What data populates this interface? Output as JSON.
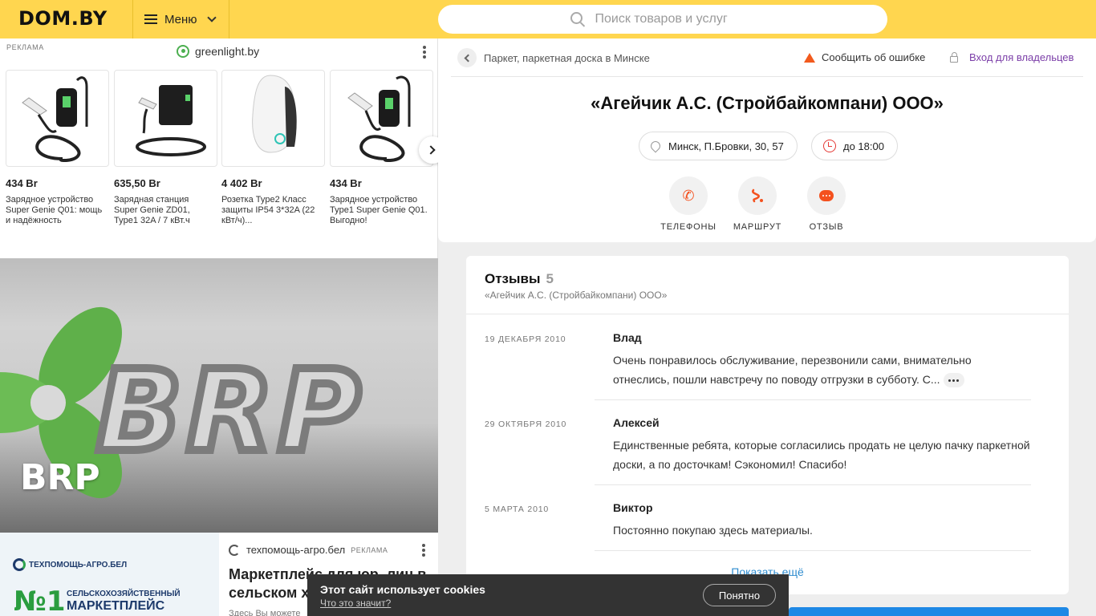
{
  "header": {
    "logo": "DOM.BY",
    "menu_label": "Меню",
    "search_placeholder": "Поиск товаров и услуг"
  },
  "ad_top": {
    "label": "РЕКЛАМА",
    "brand": "greenlight.by",
    "products": [
      {
        "price": "434 Br",
        "title": "Зарядное устройство Super Genie Q01: мощь и надёжность"
      },
      {
        "price": "635,50 Br",
        "title": "Зарядная станция Super Genie ZD01, Type1 32A / 7 кВт.ч"
      },
      {
        "price": "4 402 Br",
        "title": "Розетка Type2 Класс защиты IP54 3*32A (22 кВт/ч)..."
      },
      {
        "price": "434 Br",
        "title": "Зарядное устройство Type1 Super Genie Q01. Выгодно!"
      }
    ]
  },
  "banner": {
    "title": "BRP"
  },
  "ad_bottom": {
    "logo_text": "ТЕХПОМОЩЬ-АГРО.БЕЛ",
    "number": "№1",
    "slogan1": "СЕЛЬСКОХОЗЯЙСТВЕННЫЙ",
    "slogan2": "МАРКЕТПЛЕЙС",
    "site": "техпомощь-агро.бел",
    "label": "РЕКЛАМА",
    "headline": "Маркетплейс для юр. лиц в сельском хозяйстве",
    "desc": "Здесь Вы можете"
  },
  "company": {
    "breadcrumb": "Паркет, паркетная доска в Минске",
    "report_label": "Сообщить об ошибке",
    "owner_label": "Вход для владельцев",
    "title": "«Агейчик А.С. (Стройбайкомпани) ООО»",
    "address": "Минск, П.Бровки, 30, 57",
    "hours": "до 18:00",
    "actions": {
      "phones": "ТЕЛЕФОНЫ",
      "route": "МАРШРУТ",
      "review": "ОТЗЫВ"
    }
  },
  "reviews": {
    "heading": "Отзывы",
    "count": "5",
    "subtitle": "«Агейчик А.С. (Стройбайкомпани) ООО»",
    "items": [
      {
        "date": "19 ДЕКАБРЯ 2010",
        "author": "Влад",
        "text": "Очень понравилось обслуживание, перезвонили сами, внимательно отнеслись, пошли навстречу по поводу отгрузки в субботу. С..."
      },
      {
        "date": "29 ОКТЯБРЯ 2010",
        "author": "Алексей",
        "text": "Единственные ребята, которые согласились продать не целую пачку паркетной доски, а по досточкам! Сэкономил! Спасибо!"
      },
      {
        "date": "5 МАРТА 2010",
        "author": "Виктор",
        "text": "Постоянно покупаю здесь материалы."
      }
    ],
    "show_more": "Показать ещё"
  },
  "cookie": {
    "title": "Этот сайт использует cookies",
    "link": "Что это значит?",
    "button": "Понятно"
  }
}
